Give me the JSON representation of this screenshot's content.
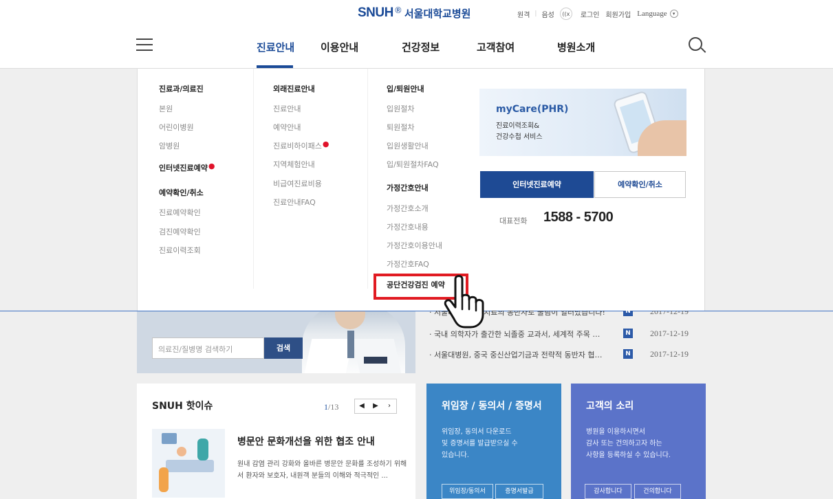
{
  "header": {
    "logo_en": "SNUH",
    "logo_mark": "®",
    "logo_ko": "서울대학교병원",
    "util": {
      "item1": "원격",
      "item2": "음성",
      "speaker_icon_text": "((x",
      "login": "로그인",
      "join": "회원가입",
      "language": "Language"
    }
  },
  "nav": {
    "items": [
      "진료안내",
      "이용안내",
      "건강정보",
      "고객참여",
      "병원소개"
    ],
    "active_index": 0
  },
  "mega": {
    "col1": {
      "head": "진료과/의료진",
      "items": [
        "본원",
        "어린이병원",
        "암병원"
      ],
      "bold1": "인터넷진료예약",
      "bold2": "예약확인/취소",
      "items2": [
        "진료예약확인",
        "검진예약확인",
        "진료이력조회"
      ]
    },
    "col2": {
      "head": "외래진료안내",
      "items": [
        "진료안내",
        "예약안내",
        "진료비하이패스",
        "지역체험안내",
        "비급여진료비용",
        "진료안내FAQ"
      ]
    },
    "col3": {
      "head": "입/퇴원안내",
      "items": [
        "입원절차",
        "퇴원절차",
        "입원생활안내",
        "입/퇴원절차FAQ"
      ],
      "head2": "가정간호안내",
      "items2": [
        "가정간호소개",
        "가정간호내용",
        "가정간호이용안내",
        "가정간호FAQ"
      ],
      "highlighted": "공단건강검진 예약"
    },
    "phr": {
      "title": "myCare(PHR)",
      "line1": "진료이력조회&",
      "line2": "건강수첩 서비스"
    },
    "btn_reserve": "인터넷진료예약",
    "btn_check": "예약확인/취소",
    "tel_label": "대표전화",
    "tel_number": "1588 - 5700"
  },
  "search": {
    "placeholder": "의료진/질병명 검색하기",
    "button": "검색"
  },
  "news": [
    {
      "title": "· 서울대병원, … 치료의 동반자로 불림이 일러났습니다!",
      "badge": "N",
      "date": "2017-12-19"
    },
    {
      "title": "· 국내 의학자가 출간한 뇌졸중 교과서, 세계적 주목 …",
      "badge": "N",
      "date": "2017-12-19"
    },
    {
      "title": "· 서울대병원, 중국 중신산업기금과 전략적 동반자 협…",
      "badge": "N",
      "date": "2017-12-19"
    }
  ],
  "issue": {
    "title": "SNUH 핫이슈",
    "page_current": "1",
    "page_total": "/13",
    "headline": "병문안 문화개선을 위한 협조 안내",
    "body": "원내 감염 관리 강화와 올바른 병문안 문화를 조성하기 위해서 환자와 보호자, 내원객 분들의 이해와 적극적인 ..."
  },
  "cards": [
    {
      "title": "위임장 / 동의서 / 증명서",
      "body": "위임장, 동의서 다운로드\n및 증명서를 발급받으실 수\n있습니다.",
      "btn1": "위임장/동의서",
      "btn2": "증명서발급",
      "color": "#3b86c6"
    },
    {
      "title": "고객의 소리",
      "body": "병원을 이용하시면서\n감사 또는 건의하고자 하는\n사항을 등록하실 수 있습니다.",
      "btn1": "감사합니다",
      "btn2": "건의합니다",
      "color": "#5b73c9"
    }
  ],
  "colors": {
    "brand": "#1a4a97",
    "highlight": "#e11b22",
    "new_dot": "#e0122a"
  }
}
